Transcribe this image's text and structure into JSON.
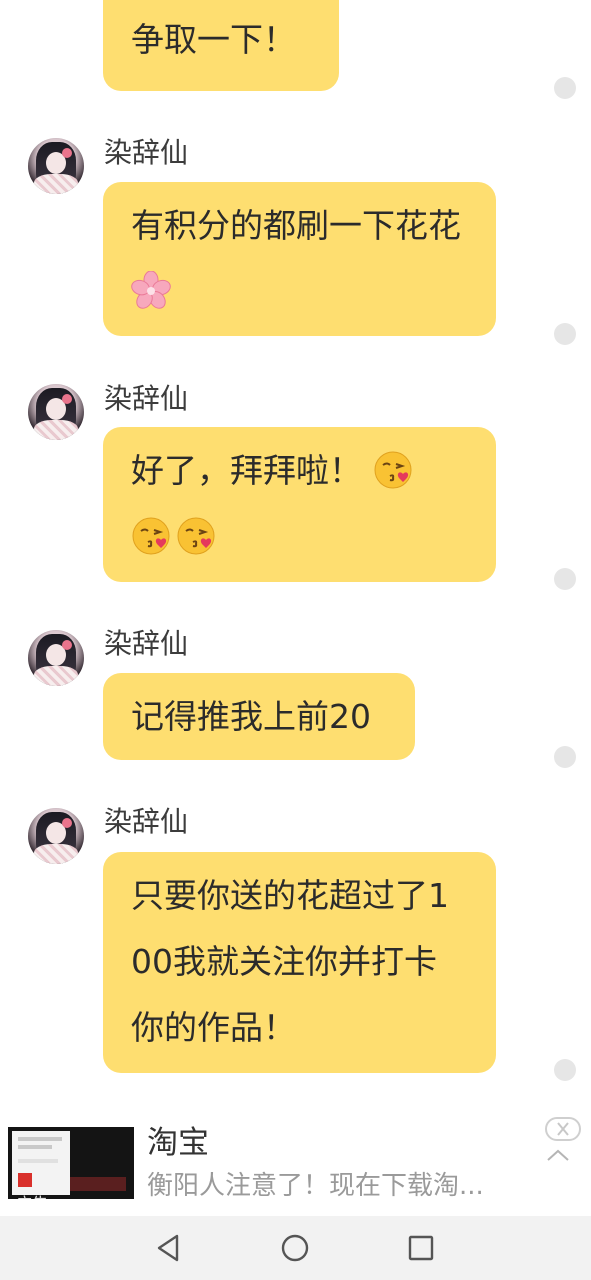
{
  "messages": [
    {
      "sender": "",
      "text": "争取一下！"
    },
    {
      "sender": "染辞仙",
      "text": "有积分的都刷一下花花",
      "emoji": [
        "cherry-blossom"
      ]
    },
    {
      "sender": "染辞仙",
      "text_line1": "好了，拜拜啦！",
      "emoji": [
        "kissing-face-with-heart",
        "kissing-face-with-heart",
        "kissing-face-with-heart"
      ]
    },
    {
      "sender": "染辞仙",
      "text": "记得推我上前20"
    },
    {
      "sender": "染辞仙",
      "text": "只要你送的花超过了100我就关注你并打卡你的作品！"
    }
  ],
  "ad": {
    "title": "淘宝",
    "text": "衡阳人注意了！现在下载淘...",
    "label": "广告",
    "icons": [
      "close-icon",
      "collapse-icon"
    ]
  },
  "navbar": {
    "icons": [
      "back-icon",
      "home-icon",
      "recents-icon"
    ]
  },
  "colors": {
    "bubble": "#fede70",
    "dot": "#e6e6e6",
    "navbar": "#f2f2f2"
  }
}
